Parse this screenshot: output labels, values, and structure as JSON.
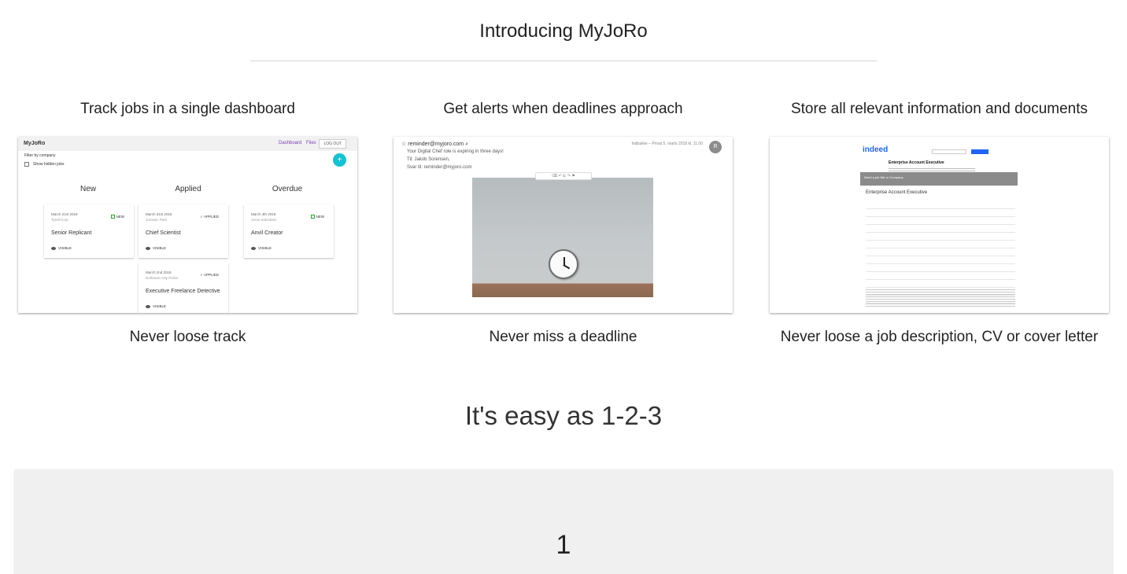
{
  "intro": {
    "title": "Introducing MyJoRo"
  },
  "features": [
    {
      "title": "Track jobs in a single dashboard",
      "caption": "Never loose track",
      "dashboard": {
        "brand": "MyJoRo",
        "nav": [
          "Dashboard",
          "Files"
        ],
        "logout": "LOG OUT",
        "filter_label": "Filter by company",
        "show_hidden": "Show hidden jobs",
        "fab": "+",
        "columns": [
          "New",
          "Applied",
          "Overdue"
        ],
        "cards": [
          {
            "date": "March 21st 2018",
            "company": "Tyrell Corp",
            "status": "NEW",
            "title": "Senior Replicant",
            "visibility": "VISIBLE"
          },
          {
            "date": "March 31st 2018",
            "company": "Jurassic Park",
            "status": "APPLIED",
            "title": "Chief Scientist",
            "visibility": "VISIBLE"
          },
          {
            "date": "March 4th 2018",
            "company": "Acme Industries",
            "status": "NEW",
            "title": "Anvil Creator",
            "visibility": "VISIBLE"
          },
          {
            "date": "March 2nd 2018",
            "company": "Dorktown City Police",
            "status": "APPLIED",
            "title": "Executive Freelance Detective",
            "visibility": "VISIBLE"
          }
        ]
      }
    },
    {
      "title": "Get alerts when deadlines approach",
      "caption": "Never miss a deadline",
      "email": {
        "from": "reminder@myjoro.com",
        "subject": "Your Digital Chef role is expiring in three days!",
        "to": "Til:  Jakob Sorensen,",
        "reply_to": "Svar til:  reminder@myjoro.com",
        "meta": "Indbakke – Privat   5. marts 2018 kl. 11.00",
        "avatar": "R"
      }
    },
    {
      "title": "Store all relevant information and documents",
      "caption": "Never loose a job description, CV or cover letter",
      "indeed": {
        "logo": "indeed",
        "job_title": "Enterprise Account Executive",
        "band_label": "Need a job title or Company",
        "desc_title": "Enterprise Account Executive"
      }
    }
  ],
  "easy": {
    "title": "It's easy as 1-2-3"
  },
  "steps": [
    {
      "number": "1"
    }
  ]
}
